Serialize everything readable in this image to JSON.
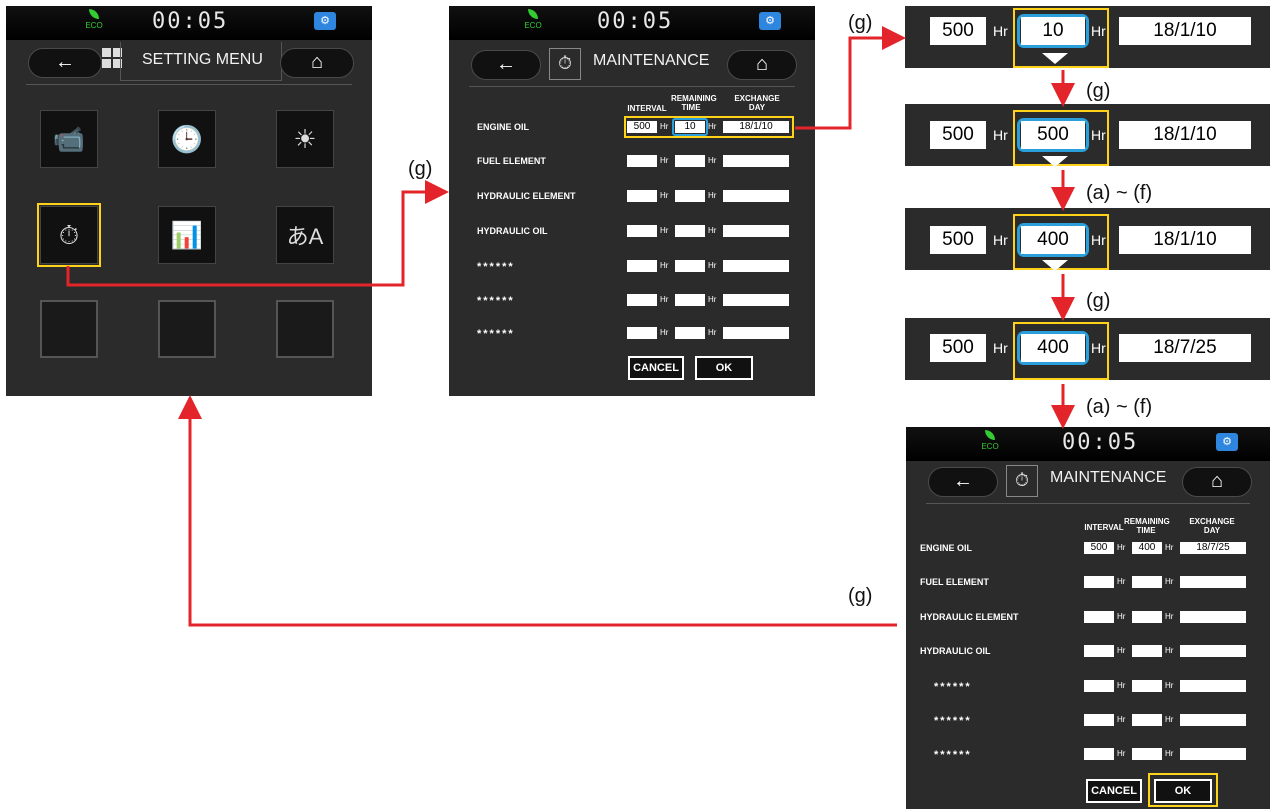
{
  "status": {
    "eco_label": "ECO",
    "clock": "00:05",
    "engine_icon": "engine-icon"
  },
  "setting_menu": {
    "back_label": "←",
    "title": "SETTING MENU",
    "home_label": "⌂",
    "tiles": [
      "camera-icon",
      "clock-icon",
      "brightness-icon",
      "maintenance-icon",
      "level-meter-icon",
      "language-icon",
      "empty",
      "empty",
      "empty"
    ]
  },
  "maintenance": {
    "title": "MAINTENANCE",
    "headers": {
      "interval": "INTERVAL",
      "remaining": "REMAINING TIME",
      "exchange": "EXCHANGE DAY"
    },
    "hr": "Hr",
    "rows": [
      {
        "label": "ENGINE OIL"
      },
      {
        "label": "FUEL ELEMENT"
      },
      {
        "label": "HYDRAULIC ELEMENT"
      },
      {
        "label": "HYDRAULIC OIL"
      },
      {
        "label": "******"
      },
      {
        "label": "******"
      },
      {
        "label": "******"
      }
    ],
    "before": {
      "interval": "500",
      "remaining": "10",
      "exchange": "18/1/10"
    },
    "after": {
      "interval": "500",
      "remaining": "400",
      "exchange": "18/7/25"
    },
    "cancel_label": "CANCEL",
    "ok_label": "OK"
  },
  "steps": [
    {
      "interval": "500",
      "remaining": "10",
      "exchange": "18/1/10"
    },
    {
      "interval": "500",
      "remaining": "500",
      "exchange": "18/1/10"
    },
    {
      "interval": "500",
      "remaining": "400",
      "exchange": "18/1/10"
    },
    {
      "interval": "500",
      "remaining": "400",
      "exchange": "18/7/25"
    }
  ],
  "annotations": {
    "g": "(g)",
    "af": "(a) ~ (f)"
  },
  "colors": {
    "highlight": "#ffd21a",
    "selection": "#2a9fdc",
    "flow_arrow": "#e3242b",
    "panel": "#2b2b2b"
  }
}
